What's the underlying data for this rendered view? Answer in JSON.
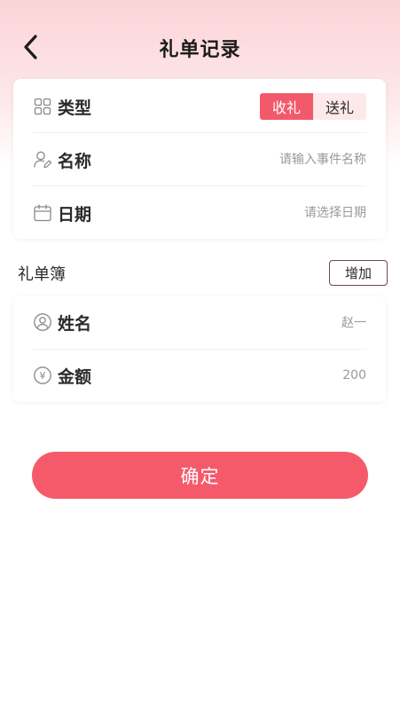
{
  "header": {
    "title": "礼单记录"
  },
  "record_form": {
    "type": {
      "label": "类型",
      "options": [
        "收礼",
        "送礼"
      ],
      "selected": "收礼"
    },
    "name": {
      "label": "名称",
      "placeholder": "请输入事件名称"
    },
    "date": {
      "label": "日期",
      "placeholder": "请选择日期"
    }
  },
  "gift_book": {
    "section_title": "礼单簿",
    "add_label": "增加",
    "person": {
      "label": "姓名",
      "value": "赵一"
    },
    "amount": {
      "label": "金额",
      "value": "200"
    }
  },
  "confirm_label": "确定",
  "colors": {
    "accent": "#f55a6b",
    "toggle_inactive_bg": "#fde8ea",
    "header_gradient_top": "#fbd4d8"
  },
  "icons": {
    "back": "chevron-left-icon",
    "type": "grid-icon",
    "name": "user-edit-icon",
    "date": "calendar-icon",
    "person": "user-circle-icon",
    "amount": "yen-circle-icon"
  }
}
